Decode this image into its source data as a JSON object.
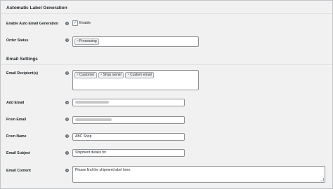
{
  "sections": {
    "auto_label": "Automatic Label Generation",
    "email_settings": "Email Settings"
  },
  "fields": {
    "enable_auto_email": {
      "label": "Enable Auto Email Generation",
      "checkbox_label": "Enable",
      "checked": true
    },
    "order_status": {
      "label": "Order Status",
      "chips": [
        "Processing"
      ]
    },
    "email_recipients": {
      "label": "Email Recipient(s)",
      "chips": [
        "Customer",
        "Shop owner",
        "Custom email"
      ]
    },
    "add_email": {
      "label": "Add Email",
      "value": ""
    },
    "from_email": {
      "label": "From Email",
      "value": ""
    },
    "from_name": {
      "label": "From Name",
      "value": "ABC Shop"
    },
    "email_subject": {
      "label": "Email Subject",
      "value": "Shipment details for"
    },
    "email_content": {
      "label": "Email Content",
      "value": "Please find the shipment label here."
    }
  },
  "chip_remove_glyph": "×",
  "help_glyph": "?",
  "check_glyph": "✓"
}
